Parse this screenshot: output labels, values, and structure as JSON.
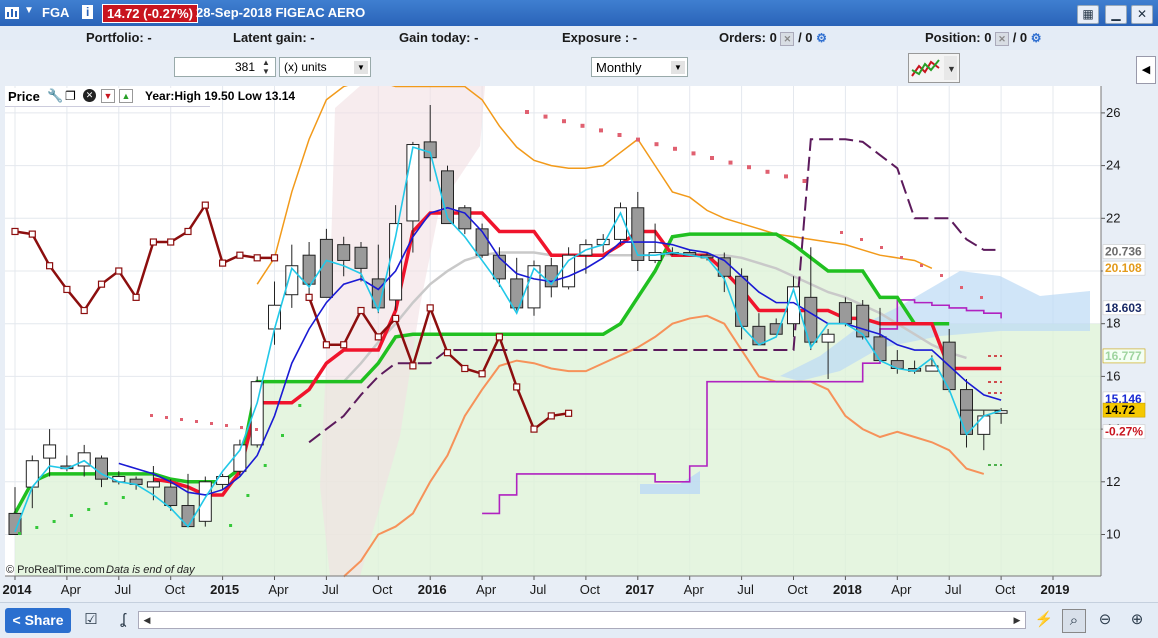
{
  "window": {
    "ticker": "FGA",
    "info_label": "i",
    "price_badge": "14.72 (-0.27%)",
    "title": "28-Sep-2018 FIGEAC AERO"
  },
  "infobar": {
    "portfolio": "Portfolio: -",
    "latent_gain": "Latent gain: -",
    "gain_today": "Gain today: -",
    "exposure": "Exposure : -",
    "orders_label": "Orders: 0",
    "orders_count": "/ 0",
    "position_label": "Position: 0",
    "position_count": "/ 0"
  },
  "controls": {
    "quantity": "381",
    "units": "(x) units",
    "period": "Monthly"
  },
  "chart_panel": {
    "label": "Price",
    "range_text": "Year:High 19.50 Low 13.14",
    "watermark": "© ProRealTime.com",
    "data_note": "Data is end of day"
  },
  "right_labels": [
    {
      "text": "20.736",
      "value": 20.736,
      "color": "#6b6b6b",
      "bg": "#ffffff"
    },
    {
      "text": "20.108",
      "value": 20.108,
      "color": "#e39a1a",
      "bg": "#ffffff"
    },
    {
      "text": "18.603",
      "value": 18.603,
      "color": "#1a2a66",
      "bg": "#ffffff"
    },
    {
      "text": "16.777",
      "value": 16.777,
      "color": "#9fd49f",
      "bg": "#f4fff4"
    },
    {
      "text": "15.146",
      "value": 15.146,
      "color": "#1a2ad4",
      "bg": "#ffffff"
    },
    {
      "text": "14.72",
      "value": 14.72,
      "color": "#000000",
      "bg": "#f5c800"
    },
    {
      "text": "-0.27%",
      "value": 13.9,
      "color": "#c8141e",
      "bg": "#ffffff"
    }
  ],
  "bottombar": {
    "share": "Share"
  },
  "chart_data": {
    "type": "candlestick",
    "title": "FIGEAC AERO",
    "period": "monthly",
    "ylim": [
      8.2,
      27
    ],
    "yticks": [
      10,
      12,
      14,
      16,
      18,
      20,
      22,
      24,
      26
    ],
    "xticks": [
      {
        "i": 0,
        "label": "2014",
        "bold": true
      },
      {
        "i": 3,
        "label": "Apr"
      },
      {
        "i": 6,
        "label": "Jul"
      },
      {
        "i": 9,
        "label": "Oct"
      },
      {
        "i": 12,
        "label": "2015",
        "bold": true
      },
      {
        "i": 15,
        "label": "Apr"
      },
      {
        "i": 18,
        "label": "Jul"
      },
      {
        "i": 21,
        "label": "Oct"
      },
      {
        "i": 24,
        "label": "2016",
        "bold": true
      },
      {
        "i": 27,
        "label": "Apr"
      },
      {
        "i": 30,
        "label": "Jul"
      },
      {
        "i": 33,
        "label": "Oct"
      },
      {
        "i": 36,
        "label": "2017",
        "bold": true
      },
      {
        "i": 39,
        "label": "Apr"
      },
      {
        "i": 42,
        "label": "Jul"
      },
      {
        "i": 45,
        "label": "Oct"
      },
      {
        "i": 48,
        "label": "2018",
        "bold": true
      },
      {
        "i": 51,
        "label": "Apr"
      },
      {
        "i": 54,
        "label": "Jul"
      },
      {
        "i": 57,
        "label": "Oct"
      },
      {
        "i": 60,
        "label": "2019",
        "bold": true
      }
    ],
    "candles": [
      [
        10.8,
        11.8,
        10.0,
        10.0
      ],
      [
        11.8,
        13.0,
        11.0,
        12.8
      ],
      [
        12.9,
        14.0,
        12.2,
        13.4
      ],
      [
        12.6,
        13.0,
        12.4,
        12.5
      ],
      [
        12.6,
        13.4,
        12.2,
        13.1
      ],
      [
        12.9,
        13.0,
        11.8,
        12.1
      ],
      [
        12.0,
        12.4,
        11.9,
        12.2
      ],
      [
        12.1,
        12.2,
        11.7,
        11.9
      ],
      [
        11.8,
        12.6,
        11.3,
        12.0
      ],
      [
        11.8,
        12.1,
        10.9,
        11.1
      ],
      [
        11.1,
        12.3,
        10.4,
        10.3
      ],
      [
        10.5,
        12.2,
        10.3,
        12.0
      ],
      [
        11.9,
        12.3,
        11.7,
        12.2
      ],
      [
        12.4,
        13.6,
        12.2,
        13.4
      ],
      [
        13.4,
        16.0,
        13.3,
        15.8
      ],
      [
        17.8,
        19.6,
        17.2,
        18.7
      ],
      [
        19.1,
        21.0,
        18.6,
        20.2
      ],
      [
        20.6,
        21.1,
        18.9,
        19.5
      ],
      [
        21.2,
        21.6,
        19.0,
        19.0
      ],
      [
        21.0,
        21.3,
        19.8,
        20.4
      ],
      [
        20.9,
        21.1,
        19.6,
        20.1
      ],
      [
        19.7,
        21.0,
        18.4,
        18.6
      ],
      [
        18.9,
        22.5,
        18.5,
        21.8
      ],
      [
        21.9,
        24.9,
        20.7,
        24.8
      ],
      [
        24.9,
        26.3,
        23.4,
        24.3
      ],
      [
        23.8,
        24.0,
        21.8,
        21.8
      ],
      [
        22.4,
        22.5,
        21.4,
        21.6
      ],
      [
        21.6,
        21.8,
        20.5,
        20.6
      ],
      [
        20.6,
        20.9,
        19.4,
        19.7
      ],
      [
        19.7,
        20.5,
        18.5,
        18.6
      ],
      [
        18.6,
        20.4,
        18.3,
        20.2
      ],
      [
        20.2,
        20.5,
        19.0,
        19.4
      ],
      [
        19.4,
        20.9,
        19.3,
        20.6
      ],
      [
        20.6,
        21.2,
        19.9,
        21.0
      ],
      [
        21.0,
        21.4,
        20.7,
        21.2
      ],
      [
        21.2,
        22.6,
        21.0,
        22.4
      ],
      [
        22.4,
        23.0,
        20.0,
        20.4
      ],
      [
        20.4,
        21.8,
        20.3,
        20.7
      ],
      [
        20.7,
        20.9,
        20.6,
        20.7
      ],
      [
        20.7,
        20.8,
        20.6,
        20.6
      ],
      [
        20.6,
        20.7,
        20.4,
        20.5
      ],
      [
        20.5,
        20.7,
        19.2,
        19.8
      ],
      [
        19.8,
        20.1,
        17.4,
        17.9
      ],
      [
        17.9,
        18.4,
        17.2,
        17.2
      ],
      [
        18.0,
        18.2,
        17.6,
        17.6
      ],
      [
        18.0,
        19.8,
        17.5,
        19.4
      ],
      [
        19.0,
        20.9,
        17.0,
        17.3
      ],
      [
        17.3,
        17.8,
        15.9,
        17.6
      ],
      [
        18.8,
        19.0,
        17.9,
        18.0
      ],
      [
        18.7,
        18.9,
        17.4,
        17.5
      ],
      [
        17.5,
        18.6,
        16.8,
        16.6
      ],
      [
        16.6,
        17.0,
        16.1,
        16.3
      ],
      [
        16.3,
        16.6,
        16.1,
        16.2
      ],
      [
        16.2,
        16.8,
        16.2,
        16.4
      ],
      [
        17.3,
        17.8,
        15.4,
        15.5
      ],
      [
        15.5,
        15.9,
        13.3,
        13.8
      ],
      [
        13.8,
        14.7,
        13.2,
        14.5
      ],
      [
        14.6,
        14.8,
        14.2,
        14.7
      ]
    ],
    "series": [
      {
        "name": "",
        "style": "cyan-line",
        "values": [
          10.1,
          11.8,
          12.6,
          12.5,
          12.8,
          12.3,
          12.0,
          11.9,
          11.5,
          11.0,
          10.3,
          11.4,
          12.4,
          13.2,
          15.0,
          17.8,
          20.1,
          19.4,
          20.4,
          20.2,
          19.9,
          18.5,
          21.3,
          24.7,
          24.5,
          22.0,
          21.3,
          20.4,
          19.5,
          18.4,
          20.1,
          19.5,
          20.4,
          20.8,
          21.0,
          22.2,
          20.6,
          20.6,
          20.7,
          20.6,
          20.5,
          19.7,
          17.9,
          17.2,
          17.5,
          19.3,
          17.1,
          18.0,
          18.0,
          17.6,
          16.6,
          16.3,
          16.2,
          16.7,
          15.5,
          13.8,
          14.5,
          14.7
        ]
      },
      {
        "name": "",
        "style": "blue-line",
        "values": [
          null,
          null,
          null,
          null,
          null,
          null,
          12.7,
          12.5,
          12.3,
          12.0,
          11.6,
          11.5,
          11.7,
          12.2,
          13.0,
          14.5,
          16.5,
          17.8,
          18.8,
          19.5,
          19.7,
          19.3,
          20.0,
          21.3,
          22.2,
          22.4,
          22.2,
          21.5,
          20.5,
          19.9,
          19.7,
          19.6,
          19.8,
          20.1,
          20.5,
          21.1,
          21.1,
          21.1,
          21.0,
          20.8,
          20.7,
          20.4,
          19.8,
          19.2,
          18.8,
          18.8,
          18.4,
          18.0,
          18.0,
          17.8,
          17.6,
          17.2,
          17.0,
          17.0,
          16.4,
          15.8,
          15.3,
          15.1
        ]
      },
      {
        "name": "",
        "style": "red-line",
        "values": [
          null,
          null,
          null,
          null,
          null,
          null,
          null,
          null,
          12.1,
          12.0,
          11.8,
          11.5,
          11.5,
          12.4,
          15.0,
          15.0,
          15.0,
          15.5,
          16.5,
          17.0,
          17.0,
          17.0,
          18.5,
          21.5,
          22.2,
          22.2,
          22.2,
          22.2,
          21.5,
          21.5,
          21.5,
          20.6,
          20.6,
          20.6,
          20.6,
          21.0,
          21.5,
          21.5,
          20.6,
          20.6,
          20.6,
          20.0,
          19.3,
          18.5,
          18.5,
          18.5,
          18.5,
          18.5,
          18.2,
          18.2,
          18.0,
          18.0,
          18.0,
          18.0,
          16.3,
          16.3,
          16.3,
          16.3
        ]
      },
      {
        "name": "",
        "style": "green-line",
        "values": [
          10.8,
          12.0,
          12.3,
          12.3,
          12.3,
          12.3,
          12.3,
          12.3,
          12.3,
          12.1,
          12.0,
          12.0,
          12.0,
          12.5,
          15.8,
          15.8,
          15.8,
          15.8,
          15.8,
          15.8,
          15.8,
          16.5,
          17.5,
          17.6,
          17.6,
          17.6,
          17.6,
          17.6,
          17.6,
          17.6,
          17.6,
          17.6,
          17.6,
          17.6,
          17.6,
          18.0,
          19.0,
          20.0,
          21.3,
          21.4,
          21.4,
          21.4,
          21.4,
          21.4,
          21.4,
          21.0,
          20.5,
          20.0,
          20.0,
          20.0,
          19.0,
          19.0,
          18.0,
          18.0,
          18.0
        ]
      },
      {
        "name": "",
        "style": "dark-red-markers",
        "values": [
          21.5,
          21.4,
          20.2,
          19.3,
          18.5,
          19.5,
          20.0,
          19.0,
          21.1,
          21.1,
          21.5,
          22.5,
          20.3,
          20.6,
          20.5,
          20.5,
          null,
          19.0,
          17.2,
          17.2,
          18.5,
          17.5,
          18.2,
          16.4,
          18.6,
          16.9,
          16.3,
          16.1,
          17.5,
          15.6,
          14.0,
          14.5,
          14.6
        ]
      },
      {
        "name": "",
        "style": "orange-band-upper",
        "values": [
          null,
          null,
          null,
          null,
          null,
          null,
          null,
          null,
          null,
          null,
          null,
          null,
          null,
          null,
          19.5,
          20.5,
          23.0,
          25.0,
          26.5,
          27.0,
          27.2,
          27.2,
          27.0,
          27.0,
          27.0,
          27.0,
          27.0,
          26.5,
          25.5,
          24.7,
          24.2,
          24.0,
          23.9,
          23.9,
          24.0,
          24.5,
          25.0,
          24.0,
          23.0,
          22.8,
          22.3,
          22.0,
          21.8,
          21.6,
          21.4,
          21.3,
          21.2,
          21.1,
          21.0,
          20.8,
          20.6,
          20.5,
          20.4,
          20.1
        ]
      },
      {
        "name": "",
        "style": "orange-band-lower",
        "values": [
          null,
          null,
          null,
          null,
          null,
          null,
          null,
          null,
          null,
          null,
          null,
          null,
          null,
          null,
          null,
          null,
          null,
          null,
          null,
          8.4,
          9.0,
          10.0,
          10.3,
          10.8,
          12.0,
          13.0,
          14.5,
          15.5,
          16.4,
          16.6,
          16.5,
          16.3,
          16.2,
          16.2,
          16.5,
          16.8,
          17.1,
          17.5,
          18.0,
          18.2,
          18.3,
          18.0,
          17.0,
          16.0,
          15.8,
          15.8,
          15.8,
          15.5,
          14.5,
          14.0,
          13.7,
          13.9,
          13.7,
          13.5,
          13.2,
          12.5,
          12.3
        ]
      },
      {
        "name": "",
        "style": "gray-average",
        "values": [
          null,
          null,
          null,
          null,
          null,
          null,
          null,
          null,
          null,
          null,
          null,
          null,
          null,
          null,
          null,
          null,
          null,
          null,
          null,
          15.8,
          16.5,
          17.3,
          18.0,
          18.8,
          19.5,
          20.0,
          20.4,
          20.6,
          20.7,
          20.7,
          20.7,
          20.6,
          20.6,
          20.6,
          20.6,
          20.6,
          20.6,
          20.6,
          20.6,
          20.6,
          20.6,
          20.6,
          20.5,
          20.3,
          20.1,
          19.8,
          19.5,
          19.2,
          19.0,
          18.7,
          18.4,
          18.0,
          17.6,
          17.2,
          16.9,
          16.7
        ]
      },
      {
        "name": "",
        "style": "purple-dash",
        "values": [
          null,
          null,
          null,
          null,
          null,
          null,
          null,
          null,
          null,
          null,
          null,
          null,
          null,
          null,
          null,
          null,
          null,
          13.5,
          14.0,
          14.5,
          15.3,
          16.0,
          16.5,
          16.5,
          16.5,
          17.0,
          17.0,
          17.0,
          17.0,
          17.0,
          17.0,
          17.0,
          17.0,
          17.0,
          17.0,
          17.0,
          17.0,
          17.0,
          17.0,
          17.0,
          17.0,
          17.0,
          17.0,
          17.0,
          17.0,
          17.0,
          25.0,
          25.0,
          25.0,
          24.9,
          24.4,
          23.9,
          22.0,
          22.0,
          22.0,
          21.2,
          20.8,
          20.8
        ]
      },
      {
        "name": "",
        "style": "magenta-line",
        "values": [
          null,
          null,
          null,
          null,
          null,
          null,
          null,
          null,
          null,
          null,
          null,
          null,
          null,
          null,
          null,
          null,
          null,
          null,
          null,
          null,
          null,
          null,
          null,
          null,
          null,
          null,
          null,
          10.8,
          11.5,
          12.3,
          12.3,
          12.3,
          12.3,
          12.3,
          12.3,
          12.3,
          12.3,
          12.0,
          12.0,
          12.6,
          15.8,
          15.8,
          15.8,
          15.8,
          15.8,
          15.8,
          15.8,
          15.8,
          15.8,
          16.5,
          17.8,
          18.9,
          18.8,
          18.7,
          18.6,
          18.5,
          18.4,
          18.2
        ]
      }
    ]
  }
}
